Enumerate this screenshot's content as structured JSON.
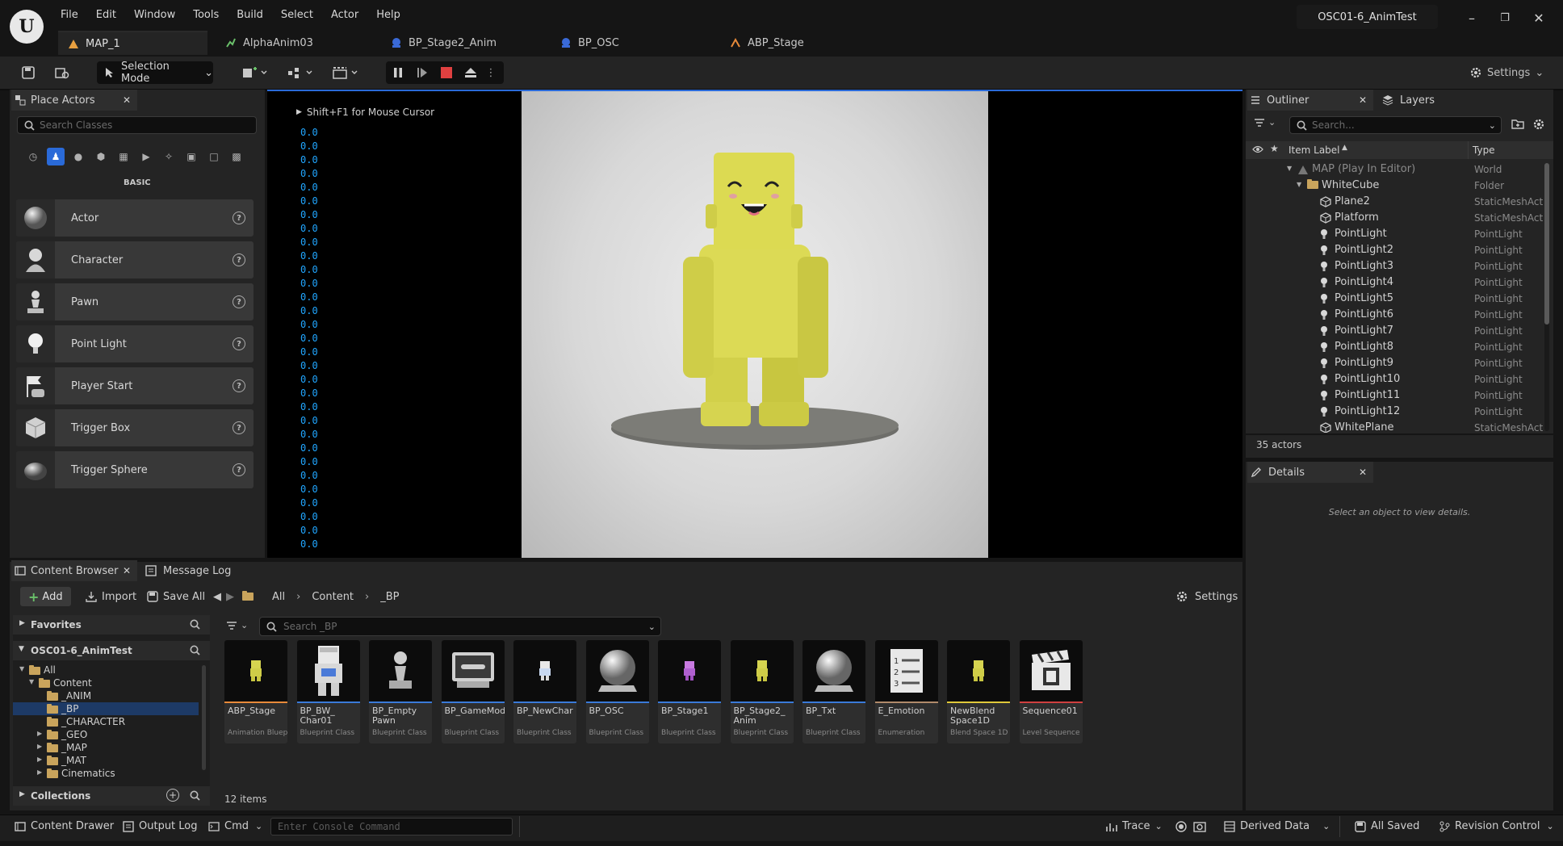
{
  "app": {
    "project_title": "OSC01-6_AnimTest",
    "menu": [
      "File",
      "Edit",
      "Window",
      "Tools",
      "Build",
      "Select",
      "Actor",
      "Help"
    ],
    "doc_tabs": [
      {
        "label": "MAP_1",
        "icon": "map-icon",
        "active": true
      },
      {
        "label": "AlphaAnim03",
        "icon": "anim-icon",
        "active": false
      },
      {
        "label": "BP_Stage2_Anim",
        "icon": "blueprint-icon",
        "active": false
      },
      {
        "label": "BP_OSC",
        "icon": "blueprint-icon",
        "active": false
      },
      {
        "label": "ABP_Stage",
        "icon": "anim-blueprint-icon",
        "active": false
      }
    ]
  },
  "toolbar": {
    "selection_mode": "Selection Mode",
    "settings_label": "Settings"
  },
  "place_actors": {
    "tab_label": "Place Actors",
    "search_placeholder": "Search Classes",
    "category_label": "BASIC",
    "items": [
      {
        "label": "Actor",
        "icon": "actor-sphere-icon"
      },
      {
        "label": "Character",
        "icon": "character-icon"
      },
      {
        "label": "Pawn",
        "icon": "pawn-icon"
      },
      {
        "label": "Point Light",
        "icon": "point-light-icon"
      },
      {
        "label": "Player Start",
        "icon": "player-start-icon"
      },
      {
        "label": "Trigger Box",
        "icon": "trigger-box-icon"
      },
      {
        "label": "Trigger Sphere",
        "icon": "trigger-sphere-icon"
      }
    ]
  },
  "viewport": {
    "hint": "Shift+F1 for Mouse Cursor",
    "stats": [
      "0.0",
      "0.0",
      "0.0",
      "0.0",
      "0.0",
      "0.0",
      "0.0",
      "0.0",
      "0.0",
      "0.0",
      "0.0",
      "0.0",
      "0.0",
      "0.0",
      "0.0",
      "0.0",
      "0.0",
      "0.0",
      "0.0",
      "0.0",
      "0.0",
      "0.0",
      "0.0",
      "0.0",
      "0.0",
      "0.0",
      "0.0",
      "0.0",
      "0.0",
      "0.0",
      "0.0"
    ]
  },
  "outliner": {
    "tab_label": "Outliner",
    "layers_label": "Layers",
    "search_placeholder": "Search...",
    "col_label": "Item Label",
    "col_type": "Type",
    "rows": [
      {
        "label": "MAP (Play In Editor)",
        "type": "World",
        "depth": 0,
        "icon": "world-icon",
        "dim": true
      },
      {
        "label": "WhiteCube",
        "type": "Folder",
        "depth": 1,
        "icon": "folder-icon",
        "dim": false
      },
      {
        "label": "Plane2",
        "type": "StaticMeshAct",
        "depth": 2,
        "icon": "static-mesh-icon",
        "dim": false
      },
      {
        "label": "Platform",
        "type": "StaticMeshAct",
        "depth": 2,
        "icon": "static-mesh-icon",
        "dim": false
      },
      {
        "label": "PointLight",
        "type": "PointLight",
        "depth": 2,
        "icon": "light-icon",
        "dim": false
      },
      {
        "label": "PointLight2",
        "type": "PointLight",
        "depth": 2,
        "icon": "light-icon",
        "dim": false
      },
      {
        "label": "PointLight3",
        "type": "PointLight",
        "depth": 2,
        "icon": "light-icon",
        "dim": false
      },
      {
        "label": "PointLight4",
        "type": "PointLight",
        "depth": 2,
        "icon": "light-icon",
        "dim": false
      },
      {
        "label": "PointLight5",
        "type": "PointLight",
        "depth": 2,
        "icon": "light-icon",
        "dim": false
      },
      {
        "label": "PointLight6",
        "type": "PointLight",
        "depth": 2,
        "icon": "light-icon",
        "dim": false
      },
      {
        "label": "PointLight7",
        "type": "PointLight",
        "depth": 2,
        "icon": "light-icon",
        "dim": false
      },
      {
        "label": "PointLight8",
        "type": "PointLight",
        "depth": 2,
        "icon": "light-icon",
        "dim": false
      },
      {
        "label": "PointLight9",
        "type": "PointLight",
        "depth": 2,
        "icon": "light-icon",
        "dim": false
      },
      {
        "label": "PointLight10",
        "type": "PointLight",
        "depth": 2,
        "icon": "light-icon",
        "dim": false
      },
      {
        "label": "PointLight11",
        "type": "PointLight",
        "depth": 2,
        "icon": "light-icon",
        "dim": false
      },
      {
        "label": "PointLight12",
        "type": "PointLight",
        "depth": 2,
        "icon": "light-icon",
        "dim": false
      },
      {
        "label": "WhitePlane",
        "type": "StaticMeshAct",
        "depth": 2,
        "icon": "static-mesh-icon",
        "dim": false
      }
    ],
    "count": "35 actors"
  },
  "details": {
    "tab_label": "Details",
    "empty_text": "Select an object to view details."
  },
  "content_browser": {
    "tab_label": "Content Browser",
    "message_log_label": "Message Log",
    "add_label": "Add",
    "import_label": "Import",
    "save_all_label": "Save All",
    "breadcrumb": [
      "All",
      "Content",
      "_BP"
    ],
    "settings_label": "Settings",
    "favorites_label": "Favorites",
    "project_label": "OSC01-6_AnimTest",
    "collections_label": "Collections",
    "search_placeholder": "Search _BP",
    "tree": [
      {
        "label": "All",
        "depth": 0,
        "selected": false,
        "arrow": "down"
      },
      {
        "label": "Content",
        "depth": 1,
        "selected": false,
        "arrow": "down"
      },
      {
        "label": "_ANIM",
        "depth": 2,
        "selected": false,
        "arrow": ""
      },
      {
        "label": "_BP",
        "depth": 2,
        "selected": true,
        "arrow": ""
      },
      {
        "label": "_CHARACTER",
        "depth": 2,
        "selected": false,
        "arrow": ""
      },
      {
        "label": "_GEO",
        "depth": 2,
        "selected": false,
        "arrow": "right"
      },
      {
        "label": "_MAP",
        "depth": 2,
        "selected": false,
        "arrow": "right"
      },
      {
        "label": "_MAT",
        "depth": 2,
        "selected": false,
        "arrow": "right"
      },
      {
        "label": "Cinematics",
        "depth": 2,
        "selected": false,
        "arrow": "right"
      }
    ],
    "assets": [
      {
        "name": "ABP_Stage",
        "type": "Animation Bluep...",
        "thumb": "yellow-char",
        "bar": "#e88a3a"
      },
      {
        "name": "BP_BW_ Char01",
        "type": "Blueprint Class",
        "thumb": "white-char",
        "bar": "#3a7ad8"
      },
      {
        "name": "BP_Empty Pawn",
        "type": "Blueprint Class",
        "thumb": "pawn",
        "bar": "#3a7ad8"
      },
      {
        "name": "BP_GameMode",
        "type": "Blueprint Class",
        "thumb": "gamemode",
        "bar": "#3a7ad8"
      },
      {
        "name": "BP_NewChar",
        "type": "Blueprint Class",
        "thumb": "small-white-char",
        "bar": "#3a7ad8"
      },
      {
        "name": "BP_OSC",
        "type": "Blueprint Class",
        "thumb": "sphere",
        "bar": "#3a7ad8"
      },
      {
        "name": "BP_Stage1",
        "type": "Blueprint Class",
        "thumb": "purple-char",
        "bar": "#3a7ad8"
      },
      {
        "name": "BP_Stage2_ Anim",
        "type": "Blueprint Class",
        "thumb": "yellow-char",
        "bar": "#3a7ad8"
      },
      {
        "name": "BP_Txt",
        "type": "Blueprint Class",
        "thumb": "sphere",
        "bar": "#3a7ad8"
      },
      {
        "name": "E_Emotion",
        "type": "Enumeration",
        "thumb": "enum",
        "bar": "#b08a6a"
      },
      {
        "name": "NewBlend Space1D",
        "type": "Blend Space 1D",
        "thumb": "yellow-char",
        "bar": "#e0c83a"
      },
      {
        "name": "Sequence01",
        "type": "Level Sequence",
        "thumb": "clapper",
        "bar": "#d04040"
      }
    ],
    "item_count": "12 items"
  },
  "statusbar": {
    "content_drawer": "Content Drawer",
    "output_log": "Output Log",
    "cmd": "Cmd",
    "console_placeholder": "Enter Console Command",
    "trace": "Trace",
    "derived_data": "Derived Data",
    "all_saved": "All Saved",
    "revision_control": "Revision Control"
  }
}
